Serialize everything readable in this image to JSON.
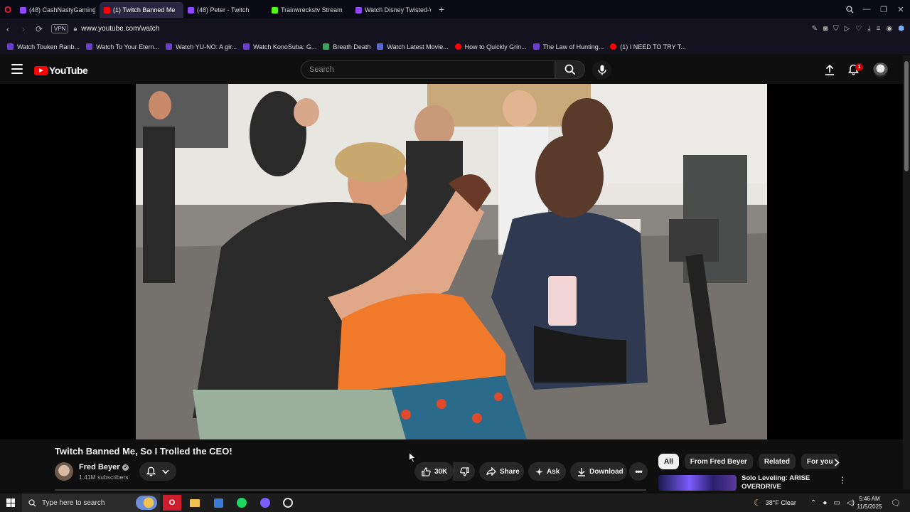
{
  "browser": {
    "tabs": [
      {
        "label": "(48) CashNastyGaming",
        "color": "#9146ff",
        "active": false
      },
      {
        "label": "(1) Twitch Banned Me",
        "color": "#ff0000",
        "active": true
      },
      {
        "label": "(48) Peter - Twitch",
        "color": "#9146ff",
        "active": false
      },
      {
        "label": "Trainwreckstv Stream",
        "color": "#53fc18",
        "active": false
      },
      {
        "label": "Watch Disney Twisted-Wo",
        "color": "#9146ff",
        "active": false
      }
    ],
    "url": "www.youtube.com/watch",
    "vpn_label": "VPN",
    "bookmarks": [
      {
        "label": "Watch Touken Ranb...",
        "color": "#6a3fd0"
      },
      {
        "label": "Watch To Your Etern...",
        "color": "#6a3fd0"
      },
      {
        "label": "Watch YU-NO: A gir...",
        "color": "#6a3fd0"
      },
      {
        "label": "Watch KonoSuba: G...",
        "color": "#6a3fd0"
      },
      {
        "label": "Breath Death",
        "color": "#3aa15a"
      },
      {
        "label": "Watch Latest Movie...",
        "color": "#5a6ad0"
      },
      {
        "label": "How to Quickly Grin...",
        "color": "#ff0000"
      },
      {
        "label": "The Law of Hunting...",
        "color": "#6a3fd0"
      },
      {
        "label": "(1) I NEED TO TRY T...",
        "color": "#ff0000"
      }
    ]
  },
  "youtube": {
    "logo_text": "YouTube",
    "search_placeholder": "Search",
    "notification_count": "1"
  },
  "video": {
    "title": "Twitch Banned Me, So I Trolled the CEO!",
    "channel": "Fred Beyer",
    "subscribers": "1.41M subscribers",
    "likes": "30K",
    "share_label": "Share",
    "ask_label": "Ask",
    "download_label": "Download"
  },
  "sidebar": {
    "chips": [
      "All",
      "From Fred Beyer",
      "Related",
      "For you"
    ],
    "selected_chip": "All",
    "recommendation_title": "Solo Leveling: ARISE OVERDRIVE"
  },
  "taskbar": {
    "search_placeholder": "Type here to search",
    "weather": "38°F  Clear",
    "time": "5:46 AM",
    "date": "11/5/2025"
  }
}
